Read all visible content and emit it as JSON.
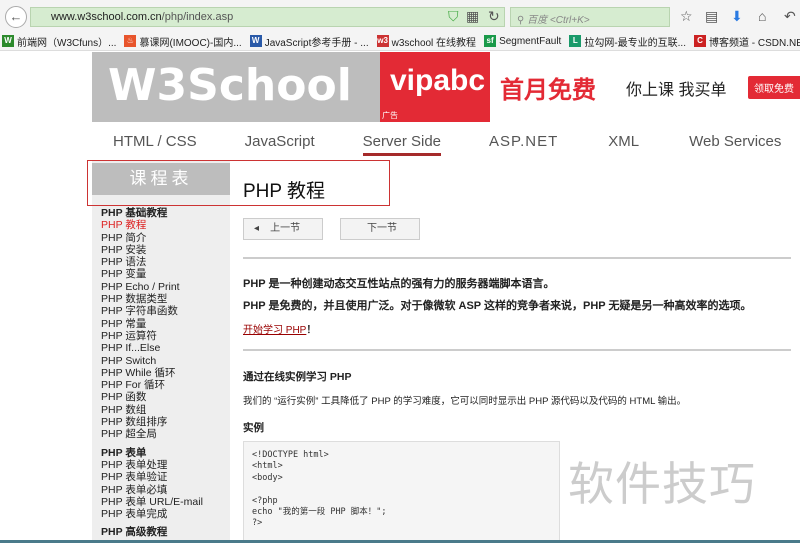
{
  "browser": {
    "url_host": "www.w3school.com.cn",
    "url_path": "/php/index.asp",
    "search_placeholder": "百度 <Ctrl+K>"
  },
  "bookmarks": [
    {
      "icon": "W",
      "label": "前端网（W3Cfuns）...",
      "color": "#2c8a2c"
    },
    {
      "icon": "♨",
      "label": "慕课网(IMOOC)-国内...",
      "color": "#e8552c"
    },
    {
      "icon": "W",
      "label": "JavaScript参考手册 - ...",
      "color": "#2a5aa8"
    },
    {
      "icon": "w3",
      "label": "w3school 在线教程",
      "color": "#c33"
    },
    {
      "icon": "sf",
      "label": "SegmentFault",
      "color": "#1a9a4a"
    },
    {
      "icon": "L",
      "label": "拉勾网-最专业的互联...",
      "color": "#1a9a6a"
    },
    {
      "icon": "C",
      "label": "博客频道 - CSDN.NET",
      "color": "#c22"
    }
  ],
  "banner": {
    "logo": "W3School",
    "ad_brand": "vipabc",
    "ad_tag": "广告",
    "ad_headline": "首月免费",
    "ad_sub": "你上课 我买单",
    "ad_button": "领取免费"
  },
  "nav": [
    "HTML / CSS",
    "JavaScript",
    "Server Side",
    "ASP.NET",
    "XML",
    "Web Services"
  ],
  "sidebar": {
    "title": "课程表",
    "groups": [
      {
        "heading": "PHP 基础教程",
        "items": [
          "PHP 教程",
          "PHP 简介",
          "PHP 安装",
          "PHP 语法",
          "PHP 变量",
          "PHP Echo / Print",
          "PHP 数据类型",
          "PHP 字符串函数",
          "PHP 常量",
          "PHP 运算符",
          "PHP If...Else",
          "PHP Switch",
          "PHP While 循环",
          "PHP For 循环",
          "PHP 函数",
          "PHP 数组",
          "PHP 数组排序",
          "PHP 超全局"
        ]
      },
      {
        "heading": "PHP 表单",
        "items": [
          "PHP 表单处理",
          "PHP 表单验证",
          "PHP 表单必填",
          "PHP 表单 URL/E-mail",
          "PHP 表单完成"
        ]
      },
      {
        "heading": "PHP 高级教程",
        "items": []
      }
    ]
  },
  "main": {
    "title": "PHP 教程",
    "prev": "上一节",
    "next": "下一节",
    "intro1": "PHP 是一种创建动态交互性站点的强有力的服务器端脚本语言。",
    "intro2": "PHP 是免费的，并且使用广泛。对于像微软 ASP 这样的竞争者来说，PHP 无疑是另一种高效率的选项。",
    "start_link": "开始学习 PHP",
    "start_suffix": "！",
    "section_title": "通过在线实例学习 PHP",
    "section_text": "我们的 “运行实例” 工具降低了 PHP 的学习难度，它可以同时显示出 PHP 源代码以及代码的 HTML 输出。",
    "example_label": "实例",
    "code": "<!DOCTYPE html>\n<html>\n<body>\n\n<?php\necho \"我的第一段 PHP 脚本！\";\n?>"
  },
  "watermark": "软件技巧"
}
